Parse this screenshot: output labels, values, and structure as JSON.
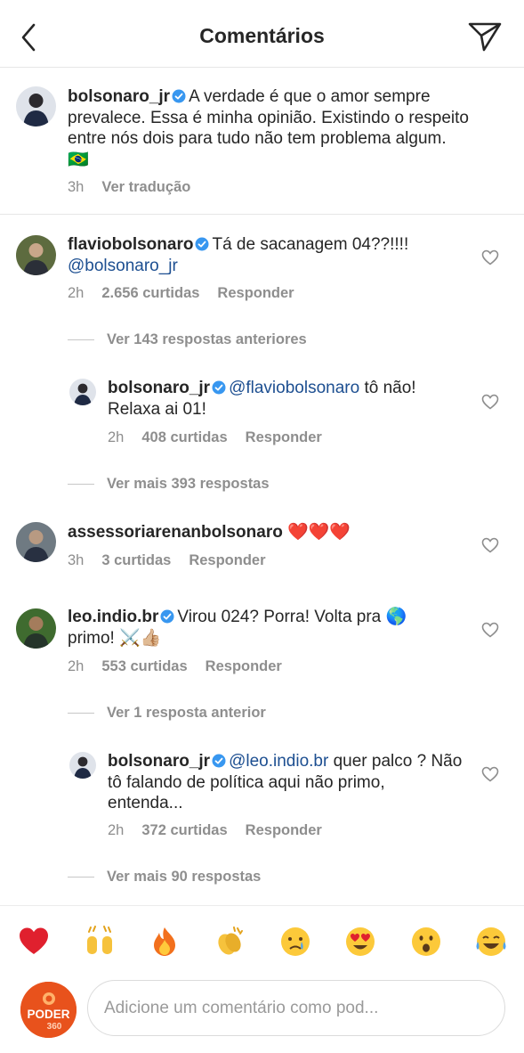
{
  "header": {
    "title": "Comentários",
    "back_icon": "chevron-left-icon",
    "share_icon": "paper-plane-icon"
  },
  "caption": {
    "username": "bolsonaro_jr",
    "verified": true,
    "text": "A verdade é que o amor sempre prevalece. Essa é minha opinião. Existindo o respeito entre nós dois para tudo não tem problema algum.",
    "flag": "🇧🇷",
    "time": "3h",
    "translate_label": "Ver tradução"
  },
  "comments": [
    {
      "username": "flaviobolsonaro",
      "verified": true,
      "text": "Tá de sacanagem 04??!!!!",
      "mention": "@bolsonaro_jr",
      "time": "2h",
      "likes": "2.656 curtidas",
      "reply_label": "Responder",
      "prev_replies": "Ver 143 respostas anteriores",
      "reply": {
        "username": "bolsonaro_jr",
        "verified": true,
        "mention": "@flaviobolsonaro",
        "text": "tô não! Relaxa ai 01!",
        "time": "2h",
        "likes": "408 curtidas",
        "reply_label": "Responder"
      },
      "more_replies": "Ver mais 393 respostas"
    },
    {
      "username": "assessoriarenanbolsonaro",
      "verified": false,
      "text": "❤️❤️❤️",
      "time": "3h",
      "likes": "3 curtidas",
      "reply_label": "Responder"
    },
    {
      "username": "leo.indio.br",
      "verified": true,
      "text_part1": "Virou 024? Porra! Volta pra",
      "globe": "🌎",
      "text_part2": "primo!",
      "emojis_tail": "⚔️👍🏼",
      "time": "2h",
      "likes": "553 curtidas",
      "reply_label": "Responder",
      "prev_replies": "Ver 1 resposta anterior",
      "reply": {
        "username": "bolsonaro_jr",
        "verified": true,
        "mention": "@leo.indio.br",
        "text": "quer palco ? Não tô falando de política aqui não primo, entenda...",
        "time": "2h",
        "likes": "372 curtidas",
        "reply_label": "Responder"
      },
      "more_replies": "Ver mais 90 respostas"
    }
  ],
  "emoji_bar": [
    "❤️",
    "🙌",
    "🔥",
    "👏",
    "😢",
    "😍",
    "😮",
    "😂"
  ],
  "composer": {
    "avatar_text_top": "PODER",
    "avatar_text_bottom": "360",
    "placeholder": "Adicione um comentário como pod..."
  },
  "colors": {
    "text": "#262626",
    "muted": "#8e8e8e",
    "mention": "#1d4f91",
    "verified": "#3897f0",
    "poder_orange": "#e8521c"
  }
}
